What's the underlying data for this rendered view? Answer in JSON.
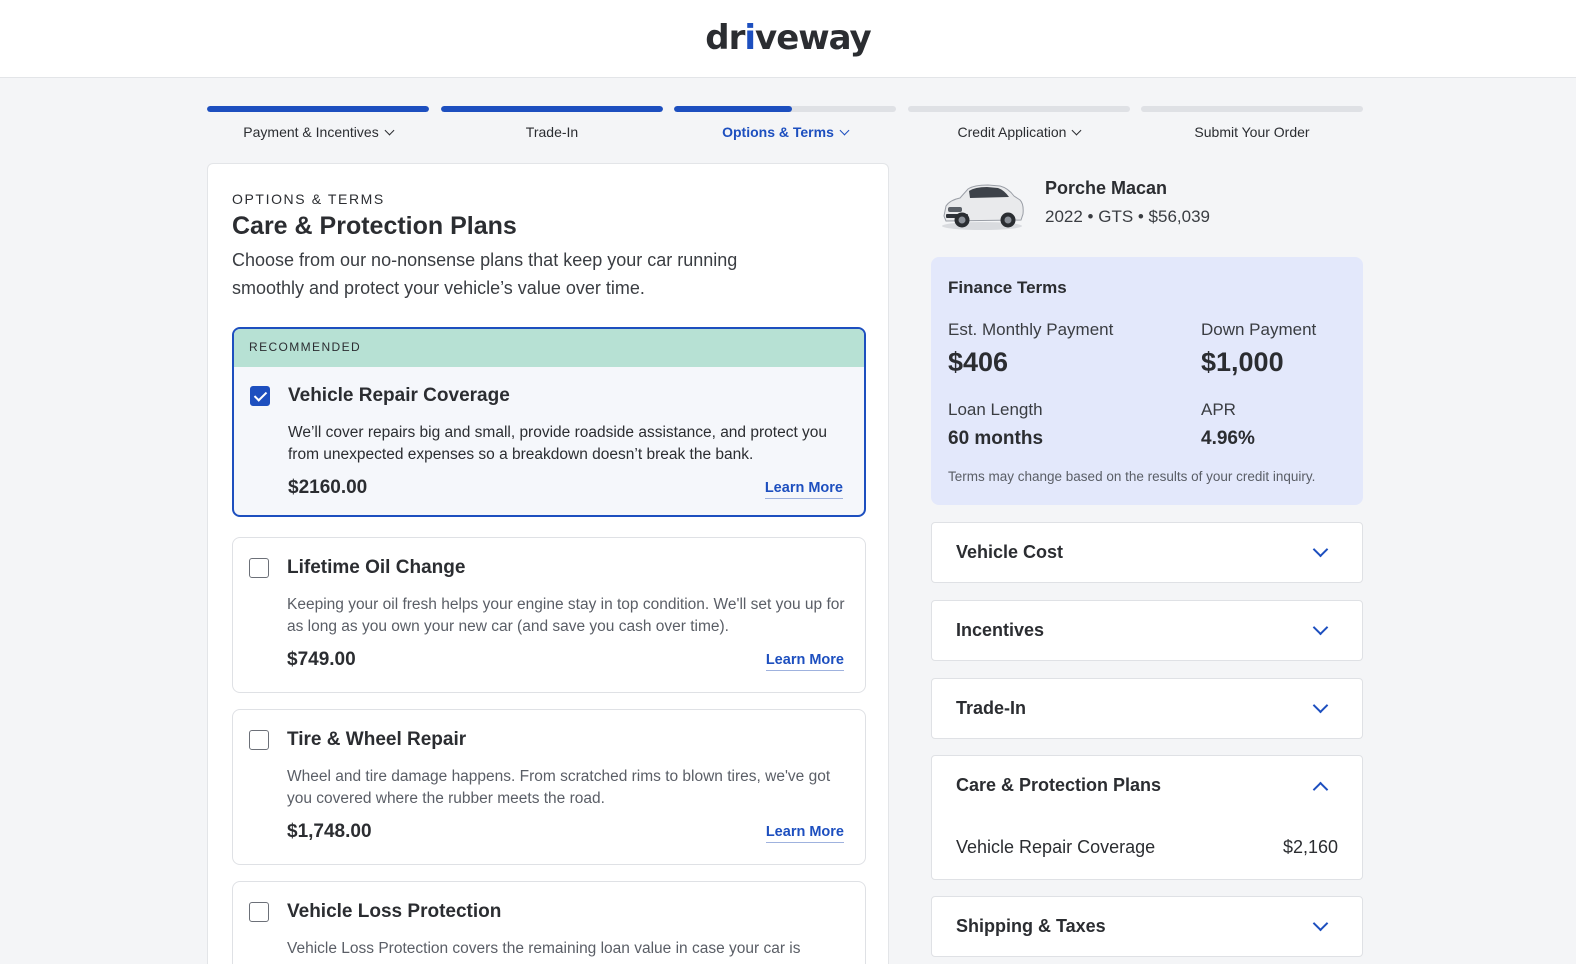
{
  "header": {
    "logo_left": "dr",
    "logo_i": "i",
    "logo_right": "veway"
  },
  "steps": [
    {
      "label": "Payment & Incentives",
      "progress": 1.0,
      "has_dropdown": true,
      "active": false
    },
    {
      "label": "Trade-In",
      "progress": 1.0,
      "has_dropdown": false,
      "active": false
    },
    {
      "label": "Options & Terms",
      "progress": 0.53,
      "has_dropdown": true,
      "active": true
    },
    {
      "label": "Credit Application",
      "progress": 0,
      "has_dropdown": true,
      "active": false
    },
    {
      "label": "Submit Your Order",
      "progress": 0,
      "has_dropdown": false,
      "active": false
    }
  ],
  "main": {
    "eyebrow": "OPTIONS & TERMS",
    "title": "Care & Protection Plans",
    "subtitle": "Choose from our no-nonsense plans that keep your car running smoothly and protect your vehicle’s value over time.",
    "plans": [
      {
        "badge": "RECOMMENDED",
        "name": "Vehicle Repair Coverage",
        "description": "We’ll cover repairs big and small, provide roadside assistance, and protect you from unexpected expenses so a breakdown doesn’t break the bank.",
        "price": "$2160.00",
        "learn_more": "Learn More",
        "checked": true
      },
      {
        "name": "Lifetime Oil Change",
        "description": "Keeping your oil fresh helps your engine stay in top condition. We'll set you up for as long as you own your new car (and save you cash over time).",
        "price": "$749.00",
        "learn_more": "Learn More",
        "checked": false
      },
      {
        "name": "Tire & Wheel Repair",
        "description": "Wheel and tire damage happens. From scratched rims to blown tires, we've got you covered where the rubber meets the road.",
        "price": "$1,748.00",
        "learn_more": "Learn More",
        "checked": false
      },
      {
        "name": "Vehicle Loss Protection",
        "description": "Vehicle Loss Protection covers the remaining loan value in case your car is",
        "checked": false
      }
    ]
  },
  "sidebar": {
    "vehicle": {
      "name": "Porche Macan",
      "details": "2022 • GTS • $56,039",
      "image_icon": "car-photo"
    },
    "finance": {
      "heading": "Finance Terms",
      "monthly_label": "Est. Monthly Payment",
      "monthly_value": "$406",
      "down_label": "Down Payment",
      "down_value": "$1,000",
      "loan_label": "Loan Length",
      "loan_value": "60 months",
      "apr_label": "APR",
      "apr_value": "4.96%",
      "note": "Terms may change based on the results of your credit inquiry."
    },
    "accordions": [
      {
        "title": "Vehicle Cost",
        "expanded": false
      },
      {
        "title": "Incentives",
        "expanded": false
      },
      {
        "title": "Trade-In",
        "expanded": false
      },
      {
        "title": "Care & Protection Plans",
        "expanded": true,
        "rows": [
          {
            "label": "Vehicle Repair Coverage",
            "value": "$2,160"
          }
        ]
      },
      {
        "title": "Shipping & Taxes",
        "expanded": false
      }
    ]
  },
  "colors": {
    "accent": "#1d4fbf",
    "recommended_band": "#b7e1d4",
    "finance_bg": "#e3e8fb",
    "page_bg": "#f4f5f7"
  }
}
